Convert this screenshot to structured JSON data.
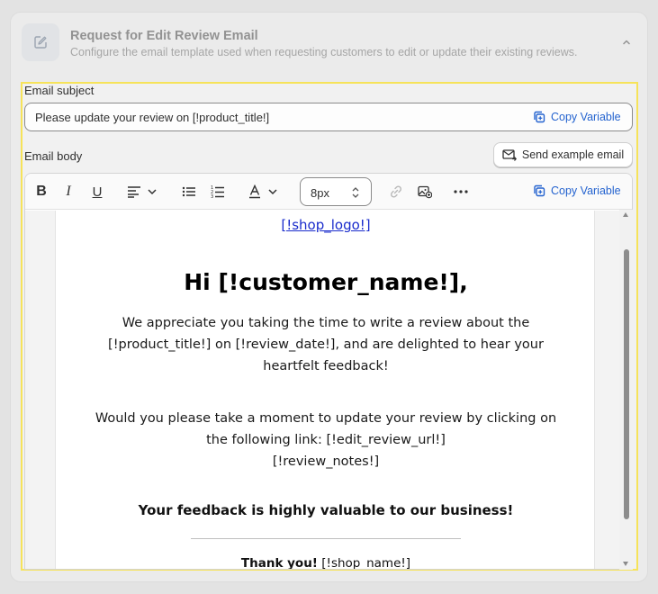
{
  "section": {
    "title": "Request for Edit Review Email",
    "description": "Configure the email template used when requesting customers to edit or update their existing reviews."
  },
  "subject": {
    "label": "Email subject",
    "value": "Please update your review on [!product_title!]",
    "copy_variable": "Copy Variable"
  },
  "body": {
    "label": "Email body",
    "send_example": "Send example email",
    "copy_variable": "Copy Variable",
    "font_size": "8px"
  },
  "email": {
    "logo": "[!shop_logo!]",
    "greeting": "Hi [!customer_name!],",
    "para1": "We appreciate you taking the time to write a review about the [!product_title!] on [!review_date!], and are delighted to hear your heartfelt feedback!",
    "para2_line1": "Would you please take a moment to update your review by clicking on the following link: [!edit_review_url!]",
    "para2_line2": "[!review_notes!]",
    "highlight": "Your feedback is highly valuable to our business!",
    "thanks_bold": "Thank you!",
    "thanks_rest": " [!shop_name!]"
  },
  "icons": {
    "section": "edit-icon",
    "collapse": "chevron-up-icon",
    "copy": "copy-icon",
    "send": "mail-icon"
  },
  "colors": {
    "accent": "#2463cf",
    "highlight_border": "#f6e35a",
    "link": "#1a2ccc"
  }
}
